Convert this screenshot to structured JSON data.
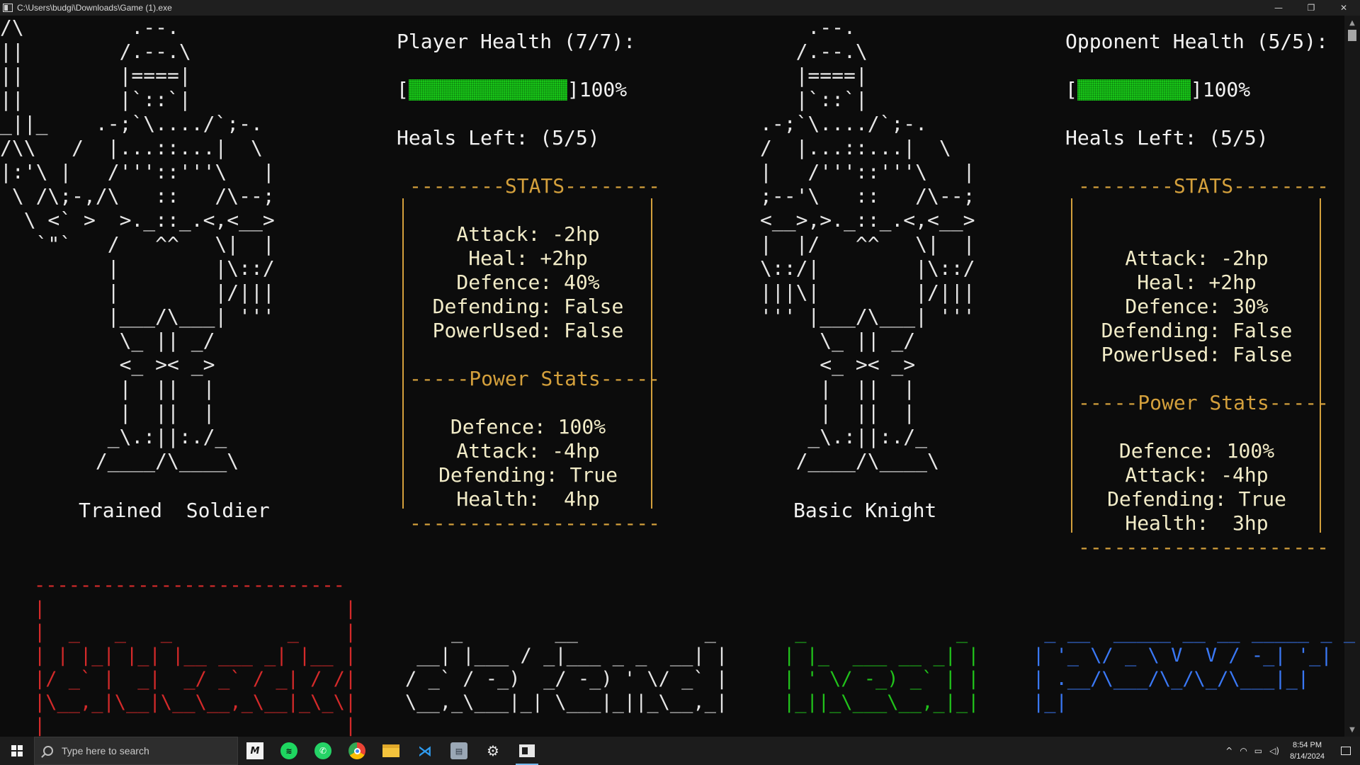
{
  "window": {
    "title": "C:\\Users\\budgi\\Downloads\\Game (1).exe",
    "minimize": "—",
    "restore": "❐",
    "close": "✕"
  },
  "player": {
    "art": "/\\         .--.\n||        /.--.\\\n||        |====|\n||        |`::`|\n_||_    .-;`\\..../`;-.\n/\\\\   /  |...::...|  \\\n|:'\\ |   /'''::'''\\   |\n \\ /\\;-,/\\   ::   /\\--;\n  \\ <` >  >._::_.<,<__>\n   `\"`   /   ^^   \\|  |\n         |        |\\::/\n         |        |/|||\n         |___/\\___| '''\n          \\_ || _/\n          <_ >< _>\n          |  ||  |\n          |  ||  |\n         _\\.:||:./_\n        /____/\\____\\",
    "name": "Trained  Soldier",
    "health_label": "Player Health (7/7):",
    "health_percent": 100,
    "health_percent_text": "]100%",
    "bar_open": "[",
    "heals_label": "Heals Left: (5/5)",
    "stats_header": "--------STATS--------",
    "stats": [
      "Attack: -2hp",
      "Heal: +2hp",
      "Defence: 40%",
      "Defending: False",
      "PowerUsed: False"
    ],
    "power_header": "-----Power Stats-----",
    "power_stats": [
      "Defence: 100%",
      "Attack: -4hp",
      "Defending: True",
      "Health:  4hp"
    ],
    "bottom_rule": "---------------------"
  },
  "opponent": {
    "art": "    .--.\n   /.--.\\\n   |====|\n   |`::`|\n.-;`\\..../`;-.\n/  |...::...|  \\\n|   /'''::'''\\   |\n;--'\\   ::   /\\--;\n<__>,>._::_.<,<__>\n|  |/   ^^   \\|  |\n\\::/|        |\\::/\n|||\\|        |/|||\n''' |___/\\___| '''\n     \\_ || _/\n     <_ >< _>\n     |  ||  |\n     |  ||  |\n    _\\.:||:./_\n   /____/\\____\\",
    "name": "Basic Knight",
    "health_label": "Opponent Health (5/5):",
    "health_percent": 100,
    "health_percent_text": "]100%",
    "bar_open": "[",
    "heals_label": "Heals Left: (5/5)",
    "stats_header": "--------STATS--------",
    "stats": [
      "Attack: -2hp",
      "Heal: +2hp",
      "Defence: 30%",
      "Defending: False",
      "PowerUsed: False"
    ],
    "power_header": "-----Power Stats-----",
    "power_stats": [
      "Defence: 100%",
      "Attack: -4hp",
      "Defending: True",
      "Health:  3hp"
    ],
    "bottom_rule": "---------------------"
  },
  "actions": {
    "attack": "---------------------------\n|                          |\n|  _   _   _          _    |\n| | |_| |_| |__ ___ _| |__ |\n|/ _` |  _|  _/ _` / _| / /|\n|\\__,_|\\__|\\__\\__,_\\__|_\\_\\|\n|                          |",
    "defend": "\n\n    _        __           _\n __| |___ / _|___ _ _  __| |\n/ _` / -_)  _/ -_) ' \\/ _` |\n\\__,_\\___|_| \\___|_||_\\__,_|",
    "heal": "\n\n _             _\n| |_  ___ __ _| |\n| ' \\/ -_) _` | |\n|_||_\\___\\__,_|_|",
    "power": "\n\n _ __  _____ __ __ _____ _ _\n| '_ \\/ _ \\ V  V / -_| '_|\n| .__/\\___/\\_/\\_/\\___|_|\n|_|"
  },
  "taskbar": {
    "search_placeholder": "Type here to search",
    "time": "8:54 PM",
    "date": "8/14/2024",
    "tray_chevron": "^"
  },
  "colors": {
    "background": "#0c0c0c",
    "stats_border": "#d4a03c",
    "player_name": "#47d1d1",
    "opponent_name": "#c71fa6",
    "attack": "#d42a2a",
    "defend": "#e6e6e6",
    "heal": "#21c21b",
    "power": "#3a78f5",
    "health_fill": "#18c418"
  }
}
